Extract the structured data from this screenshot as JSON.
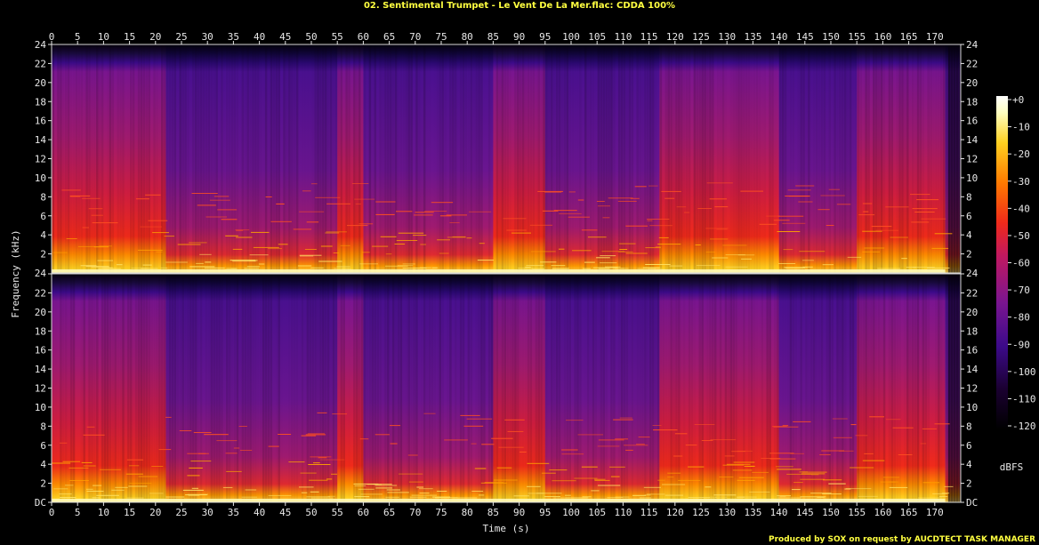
{
  "title": "02. Sentimental Trumpet - Le Vent De La Mer.flac: CDDA 100%",
  "credit": "Produced by SOX on request by AUCDTECT TASK MANAGER",
  "colors": {
    "background": "#000000",
    "text": "#e8e8e8",
    "title": "#ffff40",
    "colormap": [
      "#000000",
      "#1a0030",
      "#3c0a8a",
      "#7a1590",
      "#c01860",
      "#f02a1a",
      "#ff7a00",
      "#ffd020",
      "#ffffc0",
      "#ffffff"
    ]
  },
  "chart_data": {
    "type": "heatmap",
    "title": "02. Sentimental Trumpet - Le Vent De La Mer.flac: CDDA 100%",
    "xlabel": "Time (s)",
    "ylabel": "Frequency (kHz)",
    "x_ticks": [
      "0",
      "5",
      "10",
      "15",
      "20",
      "25",
      "30",
      "35",
      "40",
      "45",
      "50",
      "55",
      "60",
      "65",
      "70",
      "75",
      "80",
      "85",
      "90",
      "95",
      "100",
      "105",
      "110",
      "115",
      "120",
      "125",
      "130",
      "135",
      "140",
      "145",
      "150",
      "155",
      "160",
      "165",
      "170"
    ],
    "x_tick_values": [
      0,
      5,
      10,
      15,
      20,
      25,
      30,
      35,
      40,
      45,
      50,
      55,
      60,
      65,
      70,
      75,
      80,
      85,
      90,
      95,
      100,
      105,
      110,
      115,
      120,
      125,
      130,
      135,
      140,
      145,
      150,
      155,
      160,
      165,
      170
    ],
    "xlim": [
      0,
      175
    ],
    "y_ticks": [
      "DC",
      "2",
      "4",
      "6",
      "8",
      "10",
      "12",
      "14",
      "16",
      "18",
      "20",
      "22",
      "24"
    ],
    "y_tick_values": [
      0,
      2,
      4,
      6,
      8,
      10,
      12,
      14,
      16,
      18,
      20,
      22,
      24
    ],
    "ylim": [
      0,
      24
    ],
    "channels": 2,
    "colorbar": {
      "label": "dBFS",
      "ticks": [
        "+0",
        "-10",
        "-20",
        "-30",
        "-40",
        "-50",
        "-60",
        "-70",
        "-80",
        "-90",
        "-100",
        "-110",
        "-120"
      ],
      "tick_values": [
        0,
        -10,
        -20,
        -30,
        -40,
        -50,
        -60,
        -70,
        -80,
        -90,
        -100,
        -110,
        -120
      ],
      "range": [
        -120,
        0
      ]
    },
    "content_cutoff_khz": 22,
    "loud_sections_s": [
      [
        0,
        22
      ],
      [
        55,
        60
      ],
      [
        85,
        95
      ],
      [
        117,
        140
      ],
      [
        155,
        172
      ]
    ],
    "quiet_sections_s": [
      [
        22,
        55
      ],
      [
        60,
        85
      ],
      [
        95,
        117
      ],
      [
        140,
        155
      ]
    ]
  }
}
